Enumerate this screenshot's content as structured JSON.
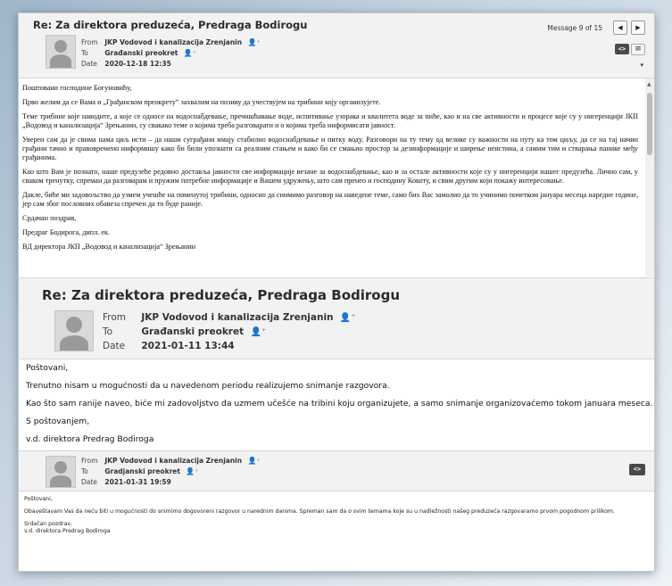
{
  "messages": [
    {
      "subject": "Re: Za direktora preduzeća, Predraga Bodirogu",
      "from_label": "From",
      "to_label": "To",
      "date_label": "Date",
      "from": "JKP Vodovod i kanalizacija Zrenjanin",
      "to": "Građanski preokret",
      "date": "2020-12-18 12:35",
      "message_counter": "Message 9 of 15",
      "body": [
        "Поштовани господине Богуновићу,",
        "Прво желим да се Вама и „Грађанском преокрету“ захвалим на позиву да учествујем на трибини коју организујете.",
        "Теме трибине које наводите, а које се односе на водоснабдевање, пречишћавање воде, испитивање узорака и квалитета воде за пиће, као и на све активности и процесе које су у нигеренцији ЈКП „Водовод и канализација“ Зрењанин, су свакако теме о којима треба разговарати и о којима треба информисати јавност.",
        "Уверен сам да је свима нама циљ исти – да наши суграђани имају стабилно водоснабдевање и питку воду. Разговори на ту тему од велике су важности на путу ка том циљу, да се на тај начин грађани тачно и правовремено информишу како би били упознати са реалним стањем и како би се смањио простор за дезинформације и ширење неистина, а самим тим и стварања панике међу грађанима.",
        "Као што Вам је познато, наше предузеће редовно доставља јавности све информације везане за водоснабдевање, као и за остале активности које су у нигеренцији нашег предузећа. Лично сам, у сваком тренутку, спреман да разговарам и пружим потребне информације и Вашем удружењу, што сам пренео и господину Кокоту, и свим другим који покажу интересовање.",
        "Дакле, биће ми задовољство да узмем учешће на поменутој трибини, односно да снимимо разговор на наведене теме, само бих Вас замолио да то учинимо почетком јануара месеца наредне године, јер сам због пословних обавеза спречен да то буде раније.",
        "Срдачан поздрав,",
        "Предраг Бодирога, дипл. ек.",
        "ВД директора ЈКП „Водовод и канализација“ Зрењанин"
      ]
    },
    {
      "subject": "Re: Za direktora preduzeća, Predraga Bodirogu",
      "from_label": "From",
      "to_label": "To",
      "date_label": "Date",
      "from": "JKP Vodovod i kanalizacija Zrenjanin",
      "to": "Građanski preokret",
      "date": "2021-01-11 13:44",
      "body": [
        "Poštovani,",
        "Trenutno nisam u mogućnosti da u navedenom periodu realizujemo snimanje razgovora.",
        "Kao što sam ranije naveo, biće mi zadovoljstvo da uzmem učešće na tribini koju organizujete, a samo snimanje organizovaćemo tokom januara meseca.",
        "S poštovanjem,",
        "v.d. direktora Predrag Bodiroga"
      ]
    },
    {
      "from_label": "From",
      "to_label": "To",
      "date_label": "Date",
      "from": "JKP Vodovod i kanalizacija Zrenjanin",
      "to": "Gradjanski preokret",
      "date": "2021-01-31 19:59",
      "body": [
        "Poštovani,",
        "Obaveštavam Vas da neću biti u mogućnosti dо snimimo dogovoreni razgovor u narednim danima. Spreman sam da o svim temama koje su u nadležnosti našeg preduzeća razgovaramo prvom pogodnom prilikom.",
        "Srdačan pozdrav,",
        "v.d. direktora Predrag Bodiroga"
      ]
    }
  ],
  "icons": {
    "prev": "chevron-left-icon",
    "next": "chevron-right-icon",
    "code_toggle": "code-view-icon",
    "menu": "hamburger-menu-icon",
    "add_contact": "add-contact-icon"
  },
  "glyphs": {
    "prev": "◀",
    "next": "▶",
    "code": "<>",
    "menu": "≡",
    "person": "👤⁺",
    "more": "▾"
  }
}
